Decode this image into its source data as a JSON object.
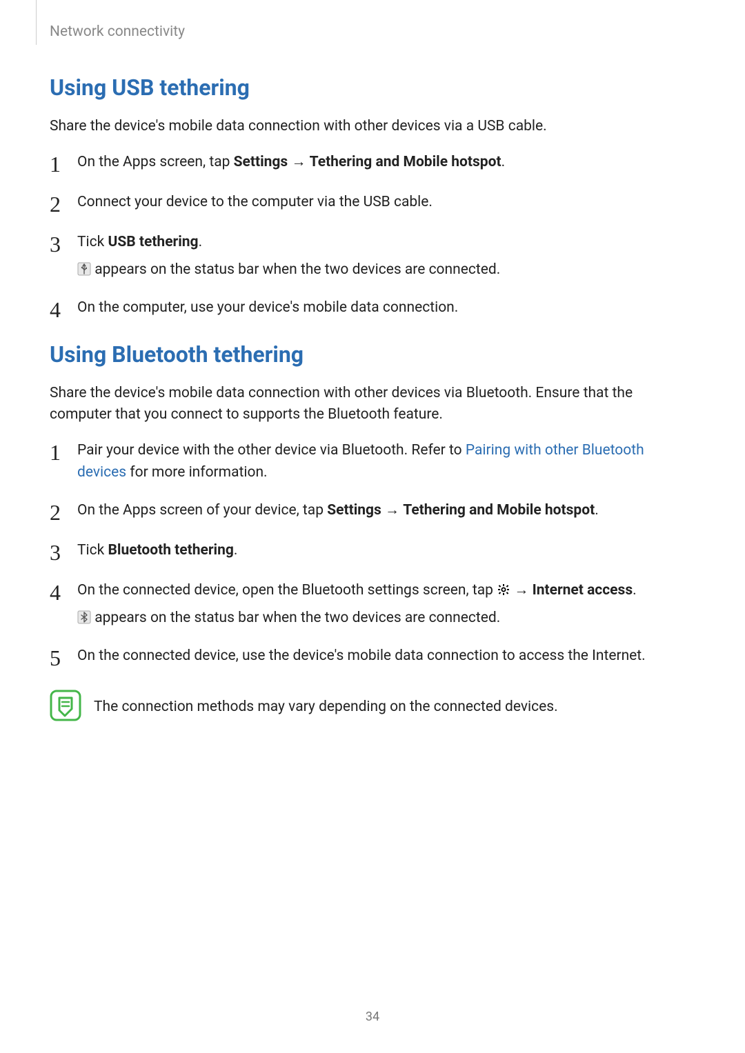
{
  "breadcrumb": "Network connectivity",
  "page_number": "34",
  "section_usb": {
    "title": "Using USB tethering",
    "intro": "Share the device's mobile data connection with other devices via a USB cable.",
    "steps": {
      "s1_pre": "On the Apps screen, tap ",
      "s1_b1": "Settings",
      "s1_arrow": " → ",
      "s1_b2": "Tethering and Mobile hotspot",
      "s1_post": ".",
      "s2": "Connect your device to the computer via the USB cable.",
      "s3_pre": "Tick ",
      "s3_b": "USB tethering",
      "s3_post": ".",
      "s3_sub": " appears on the status bar when the two devices are connected.",
      "s4": "On the computer, use your device's mobile data connection."
    }
  },
  "section_bt": {
    "title": "Using Bluetooth tethering",
    "intro": "Share the device's mobile data connection with other devices via Bluetooth. Ensure that the computer that you connect to supports the Bluetooth feature.",
    "steps": {
      "s1_pre": "Pair your device with the other device via Bluetooth. Refer to ",
      "s1_link": "Pairing with other Bluetooth devices",
      "s1_post": " for more information.",
      "s2_pre": "On the Apps screen of your device, tap ",
      "s2_b1": "Settings",
      "s2_arrow": " → ",
      "s2_b2": "Tethering and Mobile hotspot",
      "s2_post": ".",
      "s3_pre": "Tick ",
      "s3_b": "Bluetooth tethering",
      "s3_post": ".",
      "s4_pre": "On the connected device, open the Bluetooth settings screen, tap ",
      "s4_arrow": " → ",
      "s4_b": "Internet access",
      "s4_post": ".",
      "s4_sub": " appears on the status bar when the two devices are connected.",
      "s5": "On the connected device, use the device's mobile data connection to access the Internet."
    },
    "note": "The connection methods may vary depending on the connected devices."
  }
}
